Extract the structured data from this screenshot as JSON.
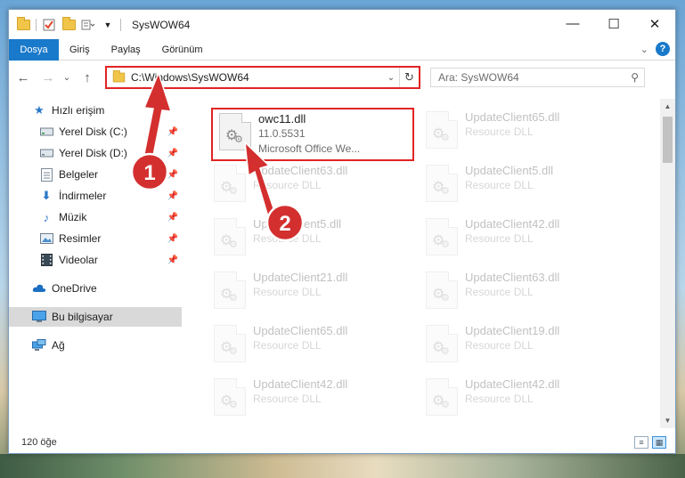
{
  "window": {
    "title": "SysWOW64",
    "minimize_glyph": "—",
    "maximize_glyph": "☐",
    "close_glyph": "✕"
  },
  "ribbon": {
    "tabs": [
      "Dosya",
      "Giriş",
      "Paylaş",
      "Görünüm"
    ],
    "help": "?"
  },
  "navigation": {
    "address": "C:\\Windows\\SysWOW64",
    "search_placeholder": "Ara: SysWOW64"
  },
  "sidebar": {
    "items": [
      {
        "label": "Hızlı erişim",
        "icon": "star-icon",
        "pinned": false
      },
      {
        "label": "Yerel Disk (C:)",
        "icon": "drive-icon",
        "pinned": true
      },
      {
        "label": "Yerel Disk (D:)",
        "icon": "drive-icon",
        "pinned": true
      },
      {
        "label": "Belgeler",
        "icon": "documents-icon",
        "pinned": true
      },
      {
        "label": "İndirmeler",
        "icon": "download-icon",
        "pinned": true
      },
      {
        "label": "Müzik",
        "icon": "music-icon",
        "pinned": true
      },
      {
        "label": "Resimler",
        "icon": "pictures-icon",
        "pinned": true
      },
      {
        "label": "Videolar",
        "icon": "video-icon",
        "pinned": true
      },
      {
        "label": "OneDrive",
        "icon": "cloud-icon",
        "pinned": false
      },
      {
        "label": "Bu bilgisayar",
        "icon": "computer-icon",
        "pinned": false,
        "selected": true
      },
      {
        "label": "Ağ",
        "icon": "network-icon",
        "pinned": false
      }
    ]
  },
  "files": [
    {
      "name": "owc11.dll",
      "line2": "11.0.5531",
      "line3": "Microsoft Office We...",
      "highlighted": true
    },
    {
      "name": "UpdateClient65.dll",
      "line2": "Resource DLL"
    },
    {
      "name": "UpdateClient63.dll",
      "line2": "Resource DLL"
    },
    {
      "name": "UpdateClient5.dll",
      "line2": "Resource DLL"
    },
    {
      "name": "UpdateClient5.dll",
      "line2": "Resource DLL"
    },
    {
      "name": "UpdateClient42.dll",
      "line2": "Resource DLL"
    },
    {
      "name": "UpdateClient21.dll",
      "line2": "Resource DLL"
    },
    {
      "name": "UpdateClient63.dll",
      "line2": "Resource DLL"
    },
    {
      "name": "UpdateClient65.dll",
      "line2": "Resource DLL"
    },
    {
      "name": "UpdateClient19.dll",
      "line2": "Resource DLL"
    },
    {
      "name": "UpdateClient42.dll",
      "line2": "Resource DLL"
    },
    {
      "name": "UpdateClient42.dll",
      "line2": "Resource DLL"
    }
  ],
  "status": {
    "item_count": "120 öğe"
  },
  "annotations": {
    "badge1": "1",
    "badge2": "2",
    "color": "#d32f2f"
  }
}
